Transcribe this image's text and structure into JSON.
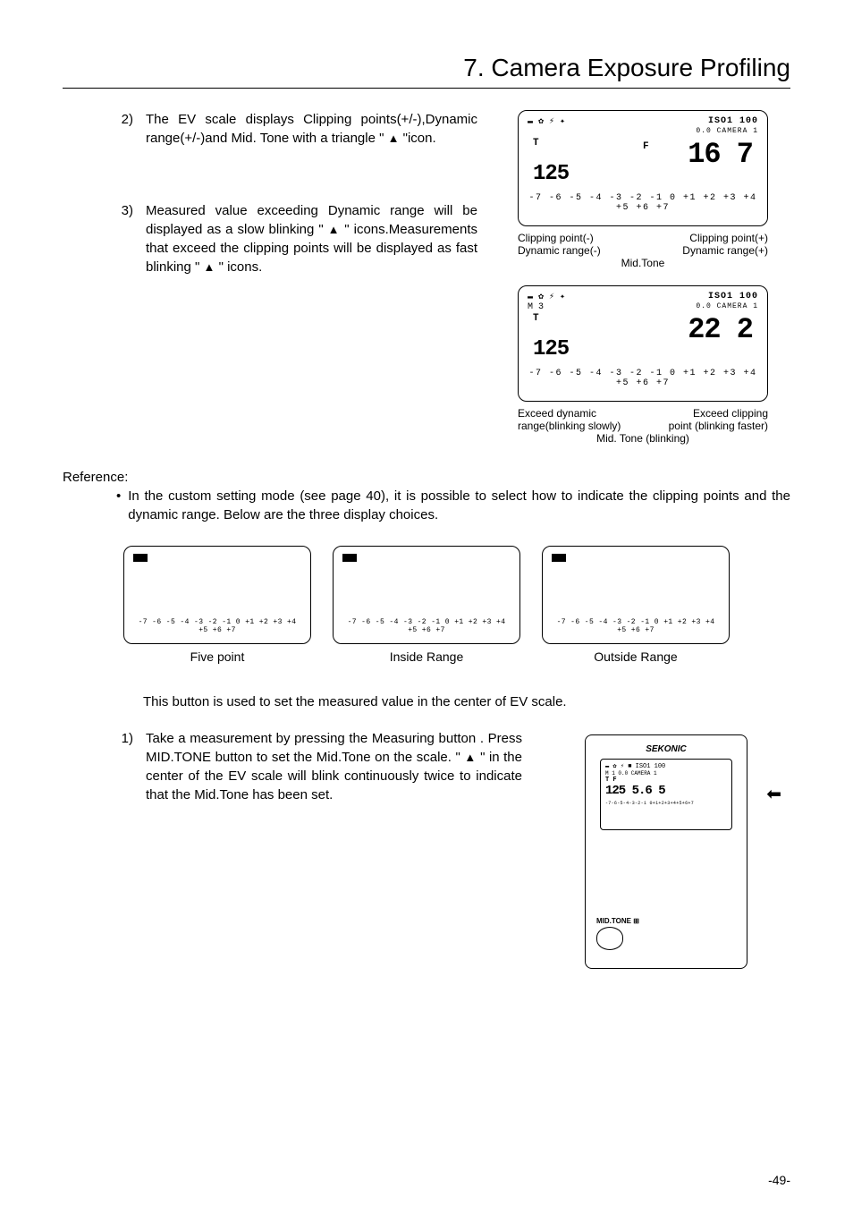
{
  "title": "7.  Camera Exposure Profiling",
  "items": {
    "i2": {
      "num": "2)",
      "text_before_tri": "The EV scale displays Clipping points(+/-),Dynamic range(+/-)and Mid. Tone with a triangle \" ",
      "text_after_tri": " \"icon."
    },
    "i3": {
      "num": "3)",
      "text_a": "Measured value exceeding Dynamic range will be displayed as a slow blinking \" ",
      "text_b": " \" icons.Measurements that exceed the clipping points will be displayed as fast blinking \" ",
      "text_c": " \" icons."
    }
  },
  "lcd1": {
    "icons_left": "▬ ✿ ⚡ ✦",
    "top_right": "ISO1  100",
    "sub_right": "0.0 CAMERA 1",
    "val_left": "T\n125",
    "val_f": "F",
    "val_right": "16 7",
    "scale": "-7 -6 -5 -4 -3 -2 -1 0 +1 +2 +3 +4 +5 +6 +7"
  },
  "labels1": {
    "clip_minus": "Clipping point(-)",
    "clip_plus": "Clipping point(+)",
    "dyn_minus": "Dynamic range(-)",
    "dyn_plus": "Dynamic range(+)",
    "mid": "Mid.Tone"
  },
  "lcd2": {
    "icons_left": "▬ ✿ ⚡ ✦",
    "top_right": "ISO1  100",
    "sub_right": "0.0 CAMERA 1",
    "m_line": "M    3",
    "val_left": "T\n125",
    "val_right": "22 2",
    "scale": "-7 -6 -5 -4 -3 -2 -1 0 +1 +2 +3 +4 +5 +6 +7"
  },
  "labels2": {
    "left_a": "Exceed dynamic",
    "left_b": "range(blinking slowly)",
    "right_a": "Exceed clipping",
    "right_b": "point (blinking faster)",
    "mid": "Mid. Tone (blinking)"
  },
  "reference": {
    "heading": "Reference:",
    "bullet": "•",
    "text": "In the custom setting mode (see page 40), it is possible to select how to indicate the clipping points and the dynamic range. Below are the three display choices."
  },
  "minis": {
    "scale_text": "-7 -6 -5 -4 -3 -2 -1 0 +1 +2 +3 +4 +5 +6 +7",
    "cap1": "Five point",
    "cap2": "Inside Range",
    "cap3": "Outside Range"
  },
  "section2": {
    "intro": "This button is used to set the measured value in the center of EV scale.",
    "item1": {
      "num": "1)",
      "text_a": "Take a measurement by pressing the Measuring button    . Press MID.TONE button     to set the Mid.Tone on the scale. \" ",
      "text_b": " \" in the center of the EV scale will blink continuously twice to indicate that the Mid.Tone has been set."
    }
  },
  "device": {
    "brand": "SEKONIC",
    "screen_top": "▬ ✿ ⚡ ■  ISO1 100",
    "screen_sub": "M  1      0.0 CAMERA 1",
    "screen_t": "T        F",
    "screen_vals": "125    5.6 5",
    "screen_scale": "-7-6-5-4-3-2-1 0+1+2+3+4+5+6+7",
    "mt_label": "MID.TONE ⊞",
    "arrow": "⬅"
  },
  "page_num": "-49-"
}
